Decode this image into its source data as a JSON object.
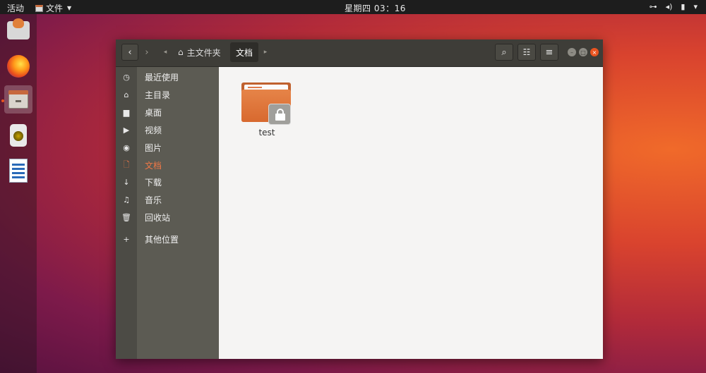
{
  "topbar": {
    "activities": "活动",
    "app_menu": "文件",
    "clock": "星期四 03：16",
    "tray": {
      "network": "⊶",
      "volume": "◂)",
      "power": "▮"
    }
  },
  "dock": {
    "items": [
      {
        "name": "installer-icon"
      },
      {
        "name": "firefox-icon"
      },
      {
        "name": "files-icon",
        "active": true
      },
      {
        "name": "speaker-icon"
      },
      {
        "name": "writer-icon"
      }
    ]
  },
  "headerbar": {
    "back": "‹",
    "forward": "›",
    "path_left": "◂",
    "path_right": "▸",
    "home_icon": "⌂",
    "home_label": "主文件夹",
    "current_label": "文档",
    "search": "⌕",
    "view_list": "☷",
    "menu": "≡"
  },
  "sidebar": {
    "items": [
      {
        "icon": "◷",
        "label": "最近使用"
      },
      {
        "icon": "⌂",
        "label": "主目录"
      },
      {
        "icon": "▆",
        "label": "桌面"
      },
      {
        "icon": "▶",
        "label": "视频"
      },
      {
        "icon": "◉",
        "label": "图片"
      },
      {
        "icon": "🗋",
        "label": "文档",
        "active": true
      },
      {
        "icon": "↓",
        "label": "下载"
      },
      {
        "icon": "♫",
        "label": "音乐"
      },
      {
        "icon": "🗑",
        "label": "回收站"
      },
      {
        "icon": "+",
        "label": "其他位置"
      }
    ]
  },
  "content": {
    "files": [
      {
        "name": "test",
        "type": "locked-folder"
      }
    ]
  },
  "colors": {
    "accent": "#e95420",
    "sidebar": "#5c5b53",
    "headerbar": "#3e3d38"
  }
}
